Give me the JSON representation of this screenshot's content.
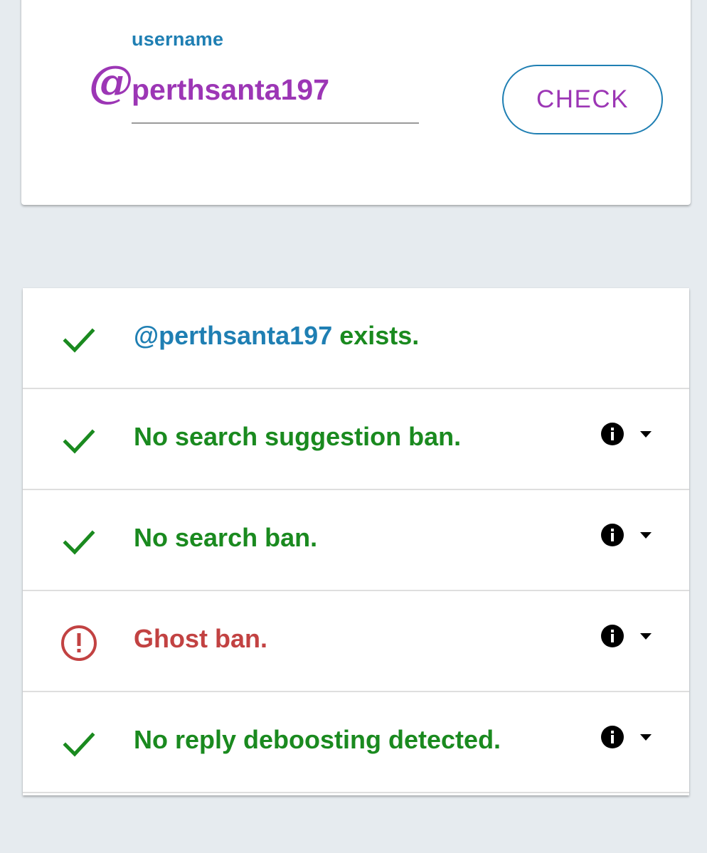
{
  "search": {
    "at_symbol": "@",
    "field_label": "username",
    "username_value": "perthsanta197",
    "check_label": "CHECK"
  },
  "results": {
    "exists": {
      "handle": "@perthsanta197",
      "suffix": " exists.",
      "status": "ok",
      "icon": "check-icon"
    },
    "items": [
      {
        "label": "No search suggestion ban.",
        "status": "ok",
        "icon": "check-icon"
      },
      {
        "label": "No search ban.",
        "status": "ok",
        "icon": "check-icon"
      },
      {
        "label": "Ghost ban.",
        "status": "bad",
        "icon": "alert-circle-icon"
      },
      {
        "label": "No reply deboosting detected.",
        "status": "ok",
        "icon": "check-icon"
      }
    ]
  },
  "colors": {
    "background": "#e6ebef",
    "accent_purple": "#9c36b5",
    "accent_blue": "#1f7fb3",
    "ok_green": "#1a8a1f",
    "error_red": "#c24242"
  }
}
